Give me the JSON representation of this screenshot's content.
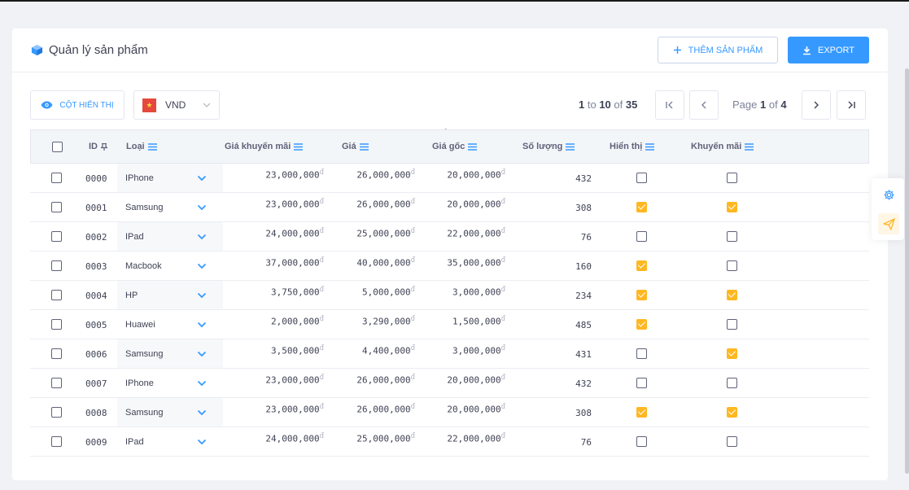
{
  "header": {
    "title": "Quản lý sản phẩm",
    "add_label": "THÊM SẢN PHẨM",
    "export_label": "EXPORT"
  },
  "toolbar": {
    "columns_label": "CỘT HIỂN THỊ",
    "currency": "VND"
  },
  "pagination": {
    "from": "1",
    "to": "10",
    "of_word": "of",
    "to_word": "to",
    "total": "35",
    "page_word": "Page",
    "page": "1",
    "page_of": "of",
    "pages": "4"
  },
  "table": {
    "columns": [
      "ID",
      "Loại",
      "Giá khuyến mãi",
      "Giá",
      "Giá gốc",
      "Số lượng",
      "Hiển thị",
      "Khuyến mãi"
    ],
    "currency_suffix": "đ",
    "rows": [
      {
        "id": "0000",
        "loai": "IPhone",
        "promo": "23,000,000",
        "price": "26,000,000",
        "orig": "20,000,000",
        "qty": "432",
        "show": false,
        "sale": false
      },
      {
        "id": "0001",
        "loai": "Samsung",
        "promo": "23,000,000",
        "price": "26,000,000",
        "orig": "20,000,000",
        "qty": "308",
        "show": true,
        "sale": true
      },
      {
        "id": "0002",
        "loai": "IPad",
        "promo": "24,000,000",
        "price": "25,000,000",
        "orig": "22,000,000",
        "qty": "76",
        "show": false,
        "sale": false
      },
      {
        "id": "0003",
        "loai": "Macbook",
        "promo": "37,000,000",
        "price": "40,000,000",
        "orig": "35,000,000",
        "qty": "160",
        "show": true,
        "sale": false
      },
      {
        "id": "0004",
        "loai": "HP",
        "promo": "3,750,000",
        "price": "5,000,000",
        "orig": "3,000,000",
        "qty": "234",
        "show": true,
        "sale": true
      },
      {
        "id": "0005",
        "loai": "Huawei",
        "promo": "2,000,000",
        "price": "3,290,000",
        "orig": "1,500,000",
        "qty": "485",
        "show": true,
        "sale": false
      },
      {
        "id": "0006",
        "loai": "Samsung",
        "promo": "3,500,000",
        "price": "4,400,000",
        "orig": "3,000,000",
        "qty": "431",
        "show": false,
        "sale": true
      },
      {
        "id": "0007",
        "loai": "IPhone",
        "promo": "23,000,000",
        "price": "26,000,000",
        "orig": "20,000,000",
        "qty": "432",
        "show": false,
        "sale": false
      },
      {
        "id": "0008",
        "loai": "Samsung",
        "promo": "23,000,000",
        "price": "26,000,000",
        "orig": "20,000,000",
        "qty": "308",
        "show": true,
        "sale": true
      },
      {
        "id": "0009",
        "loai": "IPad",
        "promo": "24,000,000",
        "price": "25,000,000",
        "orig": "22,000,000",
        "qty": "76",
        "show": false,
        "sale": false
      }
    ]
  },
  "colors": {
    "primary": "#3699ff",
    "checked": "#ffb822",
    "flag": "#e5483c"
  },
  "icons": {
    "title": "cube-icon",
    "add": "plus-icon",
    "export": "download-icon",
    "columns": "eye-icon",
    "side_settings": "gear-icon",
    "side_send": "paper-plane-icon"
  }
}
